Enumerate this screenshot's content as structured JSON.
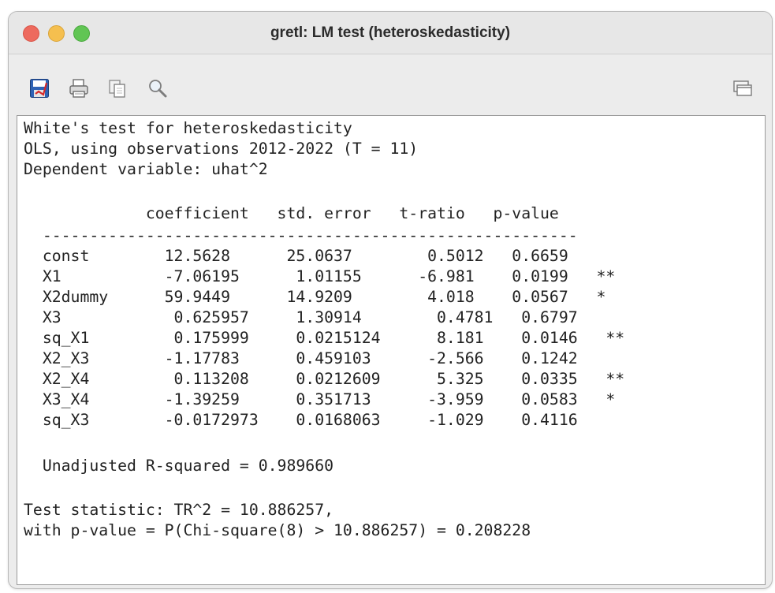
{
  "window": {
    "title": "gretl: LM test (heteroskedasticity)"
  },
  "toolbar": {
    "icons": [
      "save-icon",
      "print-icon",
      "copy-icon",
      "search-icon",
      "windows-icon"
    ]
  },
  "output": {
    "header": [
      "White's test for heteroskedasticity",
      "OLS, using observations 2012-2022 (T = 11)",
      "Dependent variable: uhat^2"
    ],
    "table_header": "             coefficient   std. error   t-ratio   p-value",
    "separator": "  ---------------------------------------------------------",
    "rows": [
      "  const        12.5628      25.0637        0.5012   0.6659",
      "  X1           -7.06195      1.01155      -6.981    0.0199   **",
      "  X2dummy      59.9449      14.9209        4.018    0.0567   *",
      "  X3            0.625957     1.30914        0.4781   0.6797",
      "  sq_X1         0.175999     0.0215124      8.181    0.0146   **",
      "  X2_X3        -1.17783      0.459103      -2.566    0.1242",
      "  X2_X4         0.113208     0.0212609      5.325    0.0335   **",
      "  X3_X4        -1.39259      0.351713      -3.959    0.0583   *",
      "  sq_X3        -0.0172973    0.0168063     -1.029    0.4116"
    ],
    "r_squared": "  Unadjusted R-squared = 0.989660",
    "test_statistic": "Test statistic: TR^2 = 10.886257,",
    "p_value_line": "with p-value = P(Chi-square(8) > 10.886257) = 0.208228"
  },
  "colors": {
    "close": "#ed6a5e",
    "minimize": "#f5bf4f",
    "maximize": "#61c554",
    "window_bg": "#ececec"
  }
}
